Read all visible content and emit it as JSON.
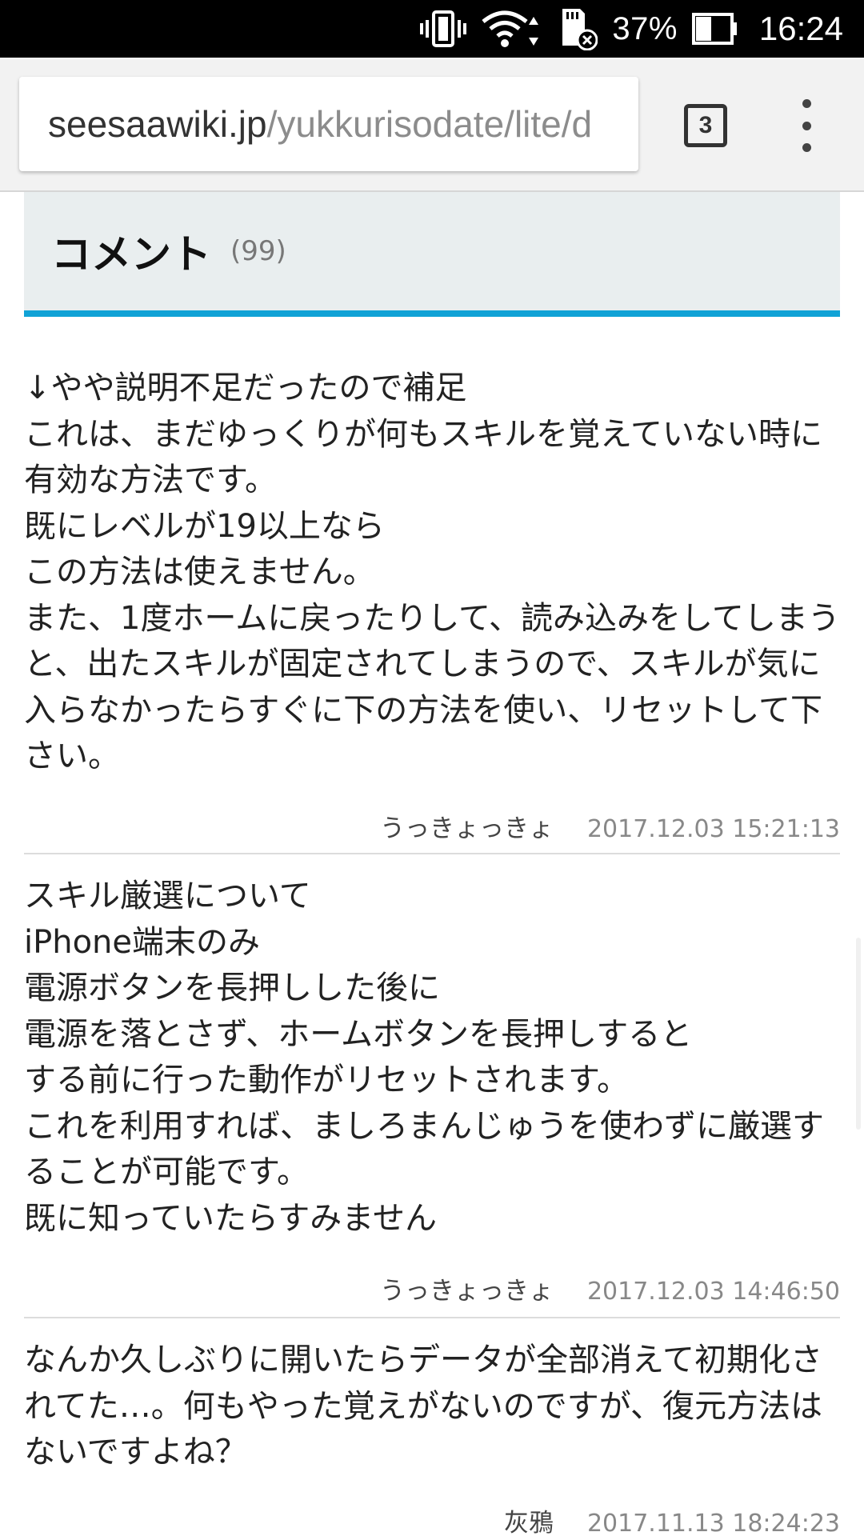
{
  "status_bar": {
    "battery_percent": "37%",
    "time": "16:24",
    "icons": [
      "vibrate-icon",
      "wifi-icon",
      "sd-card-error-icon",
      "battery-icon"
    ]
  },
  "browser": {
    "url_domain": "seesaawiki.jp",
    "url_path": "/yukkurisodate/lite/d",
    "tab_count": "3"
  },
  "comments_section": {
    "title": "コメント",
    "count": "(99)"
  },
  "comments": [
    {
      "body": "↓やや説明不足だったので補足\nこれは、まだゆっくりが何もスキルを覚えていない時に有効な方法です。\n既にレベルが19以上なら\nこの方法は使えません。\nまた、1度ホームに戻ったりして、読み込みをしてしまうと、出たスキルが固定されてしまうので、スキルが気に入らなかったらすぐに下の方法を使い、リセットして下さい。",
      "author": "うっきょっきょ",
      "date": "2017.12.03 15:21:13"
    },
    {
      "body": "スキル厳選について\niPhone端末のみ\n電源ボタンを長押しした後に\n電源を落とさず、ホームボタンを長押しすると\nする前に行った動作がリセットされます。\nこれを利用すれば、ましろまんじゅうを使わずに厳選することが可能です。\n既に知っていたらすみません",
      "author": "うっきょっきょ",
      "date": "2017.12.03 14:46:50"
    },
    {
      "body": "なんか久しぶりに開いたらデータが全部消えて初期化されてた…。何もやった覚えがないのですが、復元方法はないですよね？",
      "author": "灰鴉",
      "date": "2017.11.13 18:24:23"
    }
  ]
}
